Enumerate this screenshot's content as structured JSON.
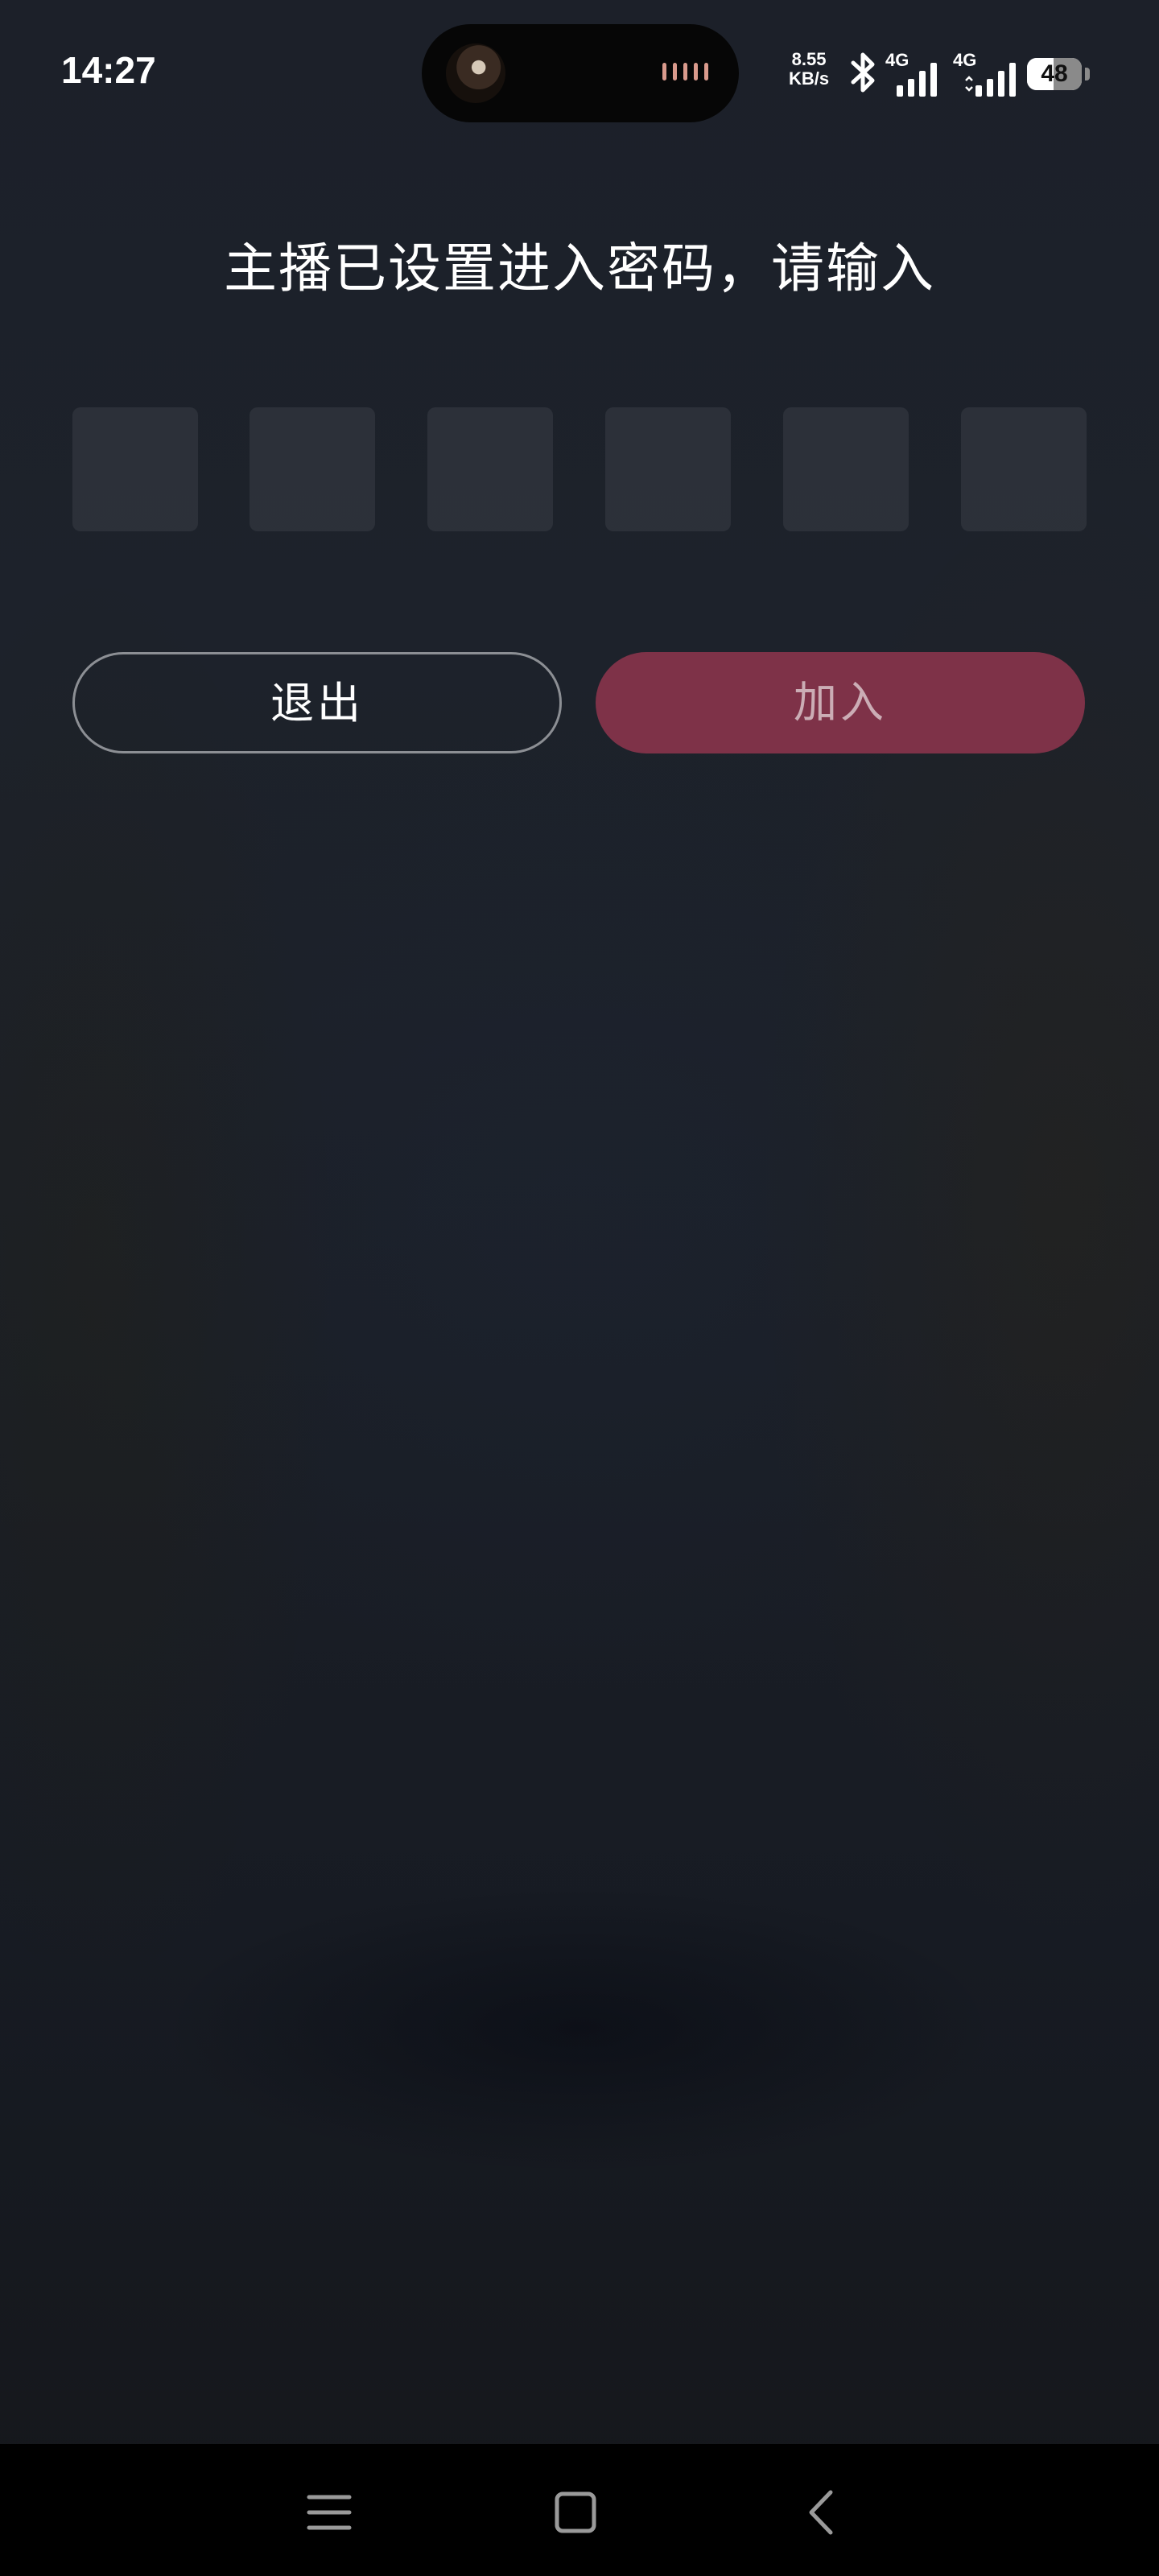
{
  "status_bar": {
    "time": "14:27",
    "net_speed_value": "8.55",
    "net_speed_unit": "KB/s",
    "sim1_label": "4G",
    "sim2_label": "4G",
    "battery_level": "48",
    "battery_percent": 48,
    "icons": [
      "bluetooth-icon",
      "signal-icon",
      "battery-icon"
    ]
  },
  "prompt": {
    "title": "主播已设置进入密码，请输入"
  },
  "password": {
    "length": 6,
    "values": [
      "",
      "",
      "",
      "",
      "",
      ""
    ]
  },
  "buttons": {
    "exit_label": "退出",
    "join_label": "加入"
  },
  "nav": {
    "icons": [
      "menu-icon",
      "home-icon",
      "back-icon"
    ]
  },
  "colors": {
    "join_button": "#7e3248",
    "exit_border": "#8c8f94",
    "password_box": "rgba(255,255,255,0.07)"
  }
}
